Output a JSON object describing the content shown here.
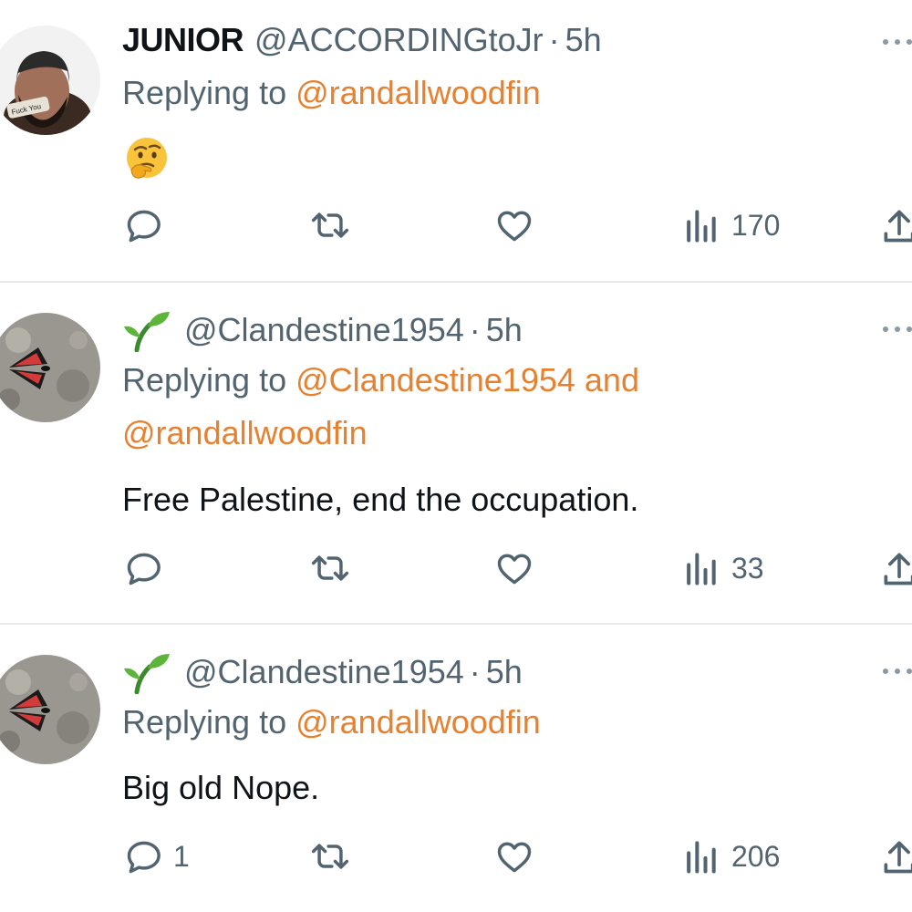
{
  "tweets": [
    {
      "name": "JUNIOR",
      "handle": "@ACCORDINGtoJr",
      "time": "5h",
      "reply_prefix": "Replying to",
      "mentions": [
        "@randallwoodfin"
      ],
      "body": "",
      "emoji": "thinking-face",
      "actions": {
        "replies": "",
        "views": "170"
      }
    },
    {
      "name": "",
      "handle": "@Clandestine1954",
      "time": "5h",
      "reply_prefix": "Replying to",
      "mentions": [
        "@Clandestine1954",
        "@randallwoodfin"
      ],
      "mention_join": "and",
      "body": "Free Palestine, end the occupation.",
      "actions": {
        "replies": "",
        "views": "33"
      }
    },
    {
      "name": "",
      "handle": "@Clandestine1954",
      "time": "5h",
      "reply_prefix": "Replying to",
      "mentions": [
        "@randallwoodfin"
      ],
      "body": "Big old Nope.",
      "actions": {
        "replies": "1",
        "views": "206"
      }
    }
  ],
  "colors": {
    "accent": "#e7812f",
    "muted": "#536471",
    "text": "#0f1419",
    "icon": "#536471"
  }
}
